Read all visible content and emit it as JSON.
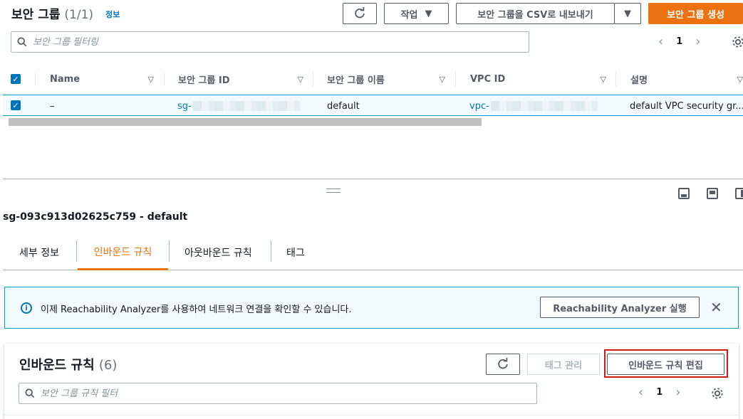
{
  "header": {
    "title": "보안 그룹",
    "count": "(1/1)",
    "info": "정보",
    "actions_label": "작업",
    "export_label": "보안 그룹을 CSV로 내보내기",
    "create_label": "보안 그룹 생성"
  },
  "filter": {
    "placeholder": "보안 그룹 필터링"
  },
  "pagination": {
    "page": "1"
  },
  "table": {
    "columns": [
      "Name",
      "보안 그룹 ID",
      "보안 그룹 이름",
      "VPC ID",
      "설명"
    ],
    "rows": [
      {
        "name": "–",
        "group_id": "sg-",
        "group_name": "default",
        "vpc_id": "vpc-",
        "description": "default VPC security gr..."
      }
    ]
  },
  "detail": {
    "title": "sg-093c913d02625c759 - default",
    "tabs": [
      "세부 정보",
      "인바운드 규칙",
      "아웃바운드 규칙",
      "태그"
    ],
    "active_tab": 1
  },
  "flash": {
    "message": "이제 Reachability Analyzer를 사용하여 네트워크 연결을 확인할 수 있습니다.",
    "button": "Reachability Analyzer 실행"
  },
  "inbound": {
    "title": "인바운드 규칙",
    "count": "(6)",
    "manage_tags": "태그 관리",
    "edit_rules": "인바운드 규칙 편집",
    "filter_placeholder": "보안 그룹 규칙 필터",
    "page": "1"
  },
  "colors": {
    "accent": "#ec7211",
    "link": "#0073bb",
    "highlight": "#d91515"
  }
}
